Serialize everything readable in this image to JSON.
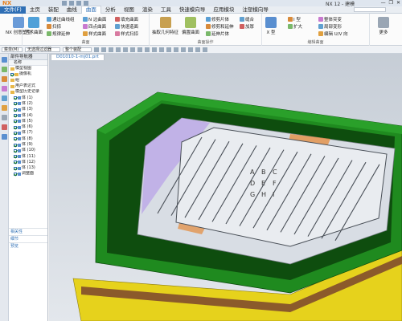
{
  "app": {
    "logo": "NX",
    "title": "NX 12 - 建模",
    "window_controls": [
      "—",
      "❐",
      "✕"
    ]
  },
  "menubar": {
    "file": "文件(F)",
    "tabs": [
      "主页",
      "装配",
      "曲线",
      "曲面",
      "分析",
      "视图",
      "渲染",
      "工具",
      "快速模向导",
      "应用模块",
      "注塑模向导"
    ],
    "active_tab": "曲面"
  },
  "ribbon": {
    "groups": [
      {
        "label": "",
        "buttons": [
          "NX 创意塑型"
        ]
      },
      {
        "label": "曲面",
        "buttons": [
          "艺术曲面",
          "通过曲线组",
          "扫掠",
          "N 边曲面",
          "规律延伸",
          "四点曲面",
          "样式曲面",
          "填充曲面",
          "快速造面",
          "样式扫掠"
        ]
      },
      {
        "label": "曲面操作",
        "buttons": [
          "抽取几何特征",
          "偏置曲面",
          "修剪片体",
          "修剪和延伸",
          "延伸片体",
          "缝合",
          "加厚"
        ]
      },
      {
        "label": "编辑曲面",
        "buttons": [
          "X 型",
          "I 型",
          "扩大",
          "整体突变",
          "局部变形",
          "编辑 U/V 向"
        ]
      },
      {
        "label": "",
        "buttons": [
          "更多"
        ]
      }
    ]
  },
  "filterbar": {
    "menu": "菜单(M)",
    "filter": "无选择过滤器",
    "scope": "整个装配"
  },
  "navigator": {
    "title": "部件导航器",
    "column": "名称",
    "items": [
      {
        "label": "模型视图",
        "type": "folder",
        "checked": false
      },
      {
        "label": "摄像机",
        "type": "folder",
        "checked": true
      },
      {
        "label": "组",
        "type": "folder",
        "checked": false
      },
      {
        "label": "用户表达式",
        "type": "folder",
        "checked": false
      },
      {
        "label": "模型历史记录",
        "type": "folder",
        "checked": false
      },
      {
        "label": "体 (1)",
        "type": "feat",
        "checked": true
      },
      {
        "label": "体 (2)",
        "type": "feat",
        "checked": true
      },
      {
        "label": "体 (3)",
        "type": "feat",
        "checked": true
      },
      {
        "label": "体 (4)",
        "type": "feat",
        "checked": true
      },
      {
        "label": "体 (5)",
        "type": "feat",
        "checked": true
      },
      {
        "label": "体 (6)",
        "type": "feat",
        "checked": true
      },
      {
        "label": "体 (7)",
        "type": "feat",
        "checked": true
      },
      {
        "label": "体 (8)",
        "type": "feat",
        "checked": true
      },
      {
        "label": "体 (9)",
        "type": "feat",
        "checked": true
      },
      {
        "label": "体 (10)",
        "type": "feat",
        "checked": true
      },
      {
        "label": "体 (11)",
        "type": "feat",
        "checked": true
      },
      {
        "label": "体 (12)",
        "type": "feat",
        "checked": true
      },
      {
        "label": "体 (13)",
        "type": "feat",
        "checked": true
      },
      {
        "label": "调整面",
        "type": "feat",
        "checked": true
      }
    ],
    "sections": [
      "相关性",
      "细节",
      "预览"
    ]
  },
  "viewport": {
    "document_tab": "D01010-1-mj01.prt",
    "colors": {
      "frame_green": "#1f8a1f",
      "frame_dark": "#0e4d0e",
      "base_yellow": "#e6d21c",
      "base_brown": "#8b5a2b",
      "insert_grey": "#d8dde4",
      "stripe": "#4a5058",
      "accent_orange": "#e58a3a",
      "accent_purple": "#b8a0e8"
    },
    "stamp_text": [
      "A",
      "B",
      "C",
      "D",
      "E",
      "F",
      "G",
      "H",
      "I"
    ]
  }
}
